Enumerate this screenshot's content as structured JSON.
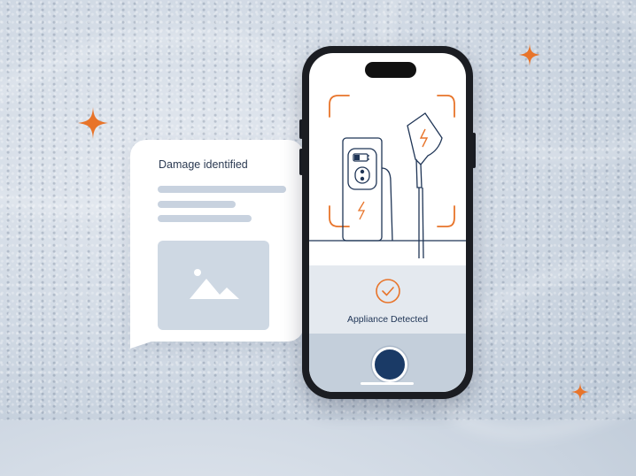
{
  "card": {
    "title": "Damage identified",
    "icon": "image-placeholder-icon"
  },
  "phone": {
    "status_text": "Appliance Detected",
    "status_icon": "check-circle-icon",
    "shutter_icon": "camera-shutter-icon",
    "illustration": "ev-charger-icon"
  },
  "colors": {
    "accent_orange": "#e8742a",
    "navy": "#1a3a66",
    "card_bg": "#ffffff"
  }
}
